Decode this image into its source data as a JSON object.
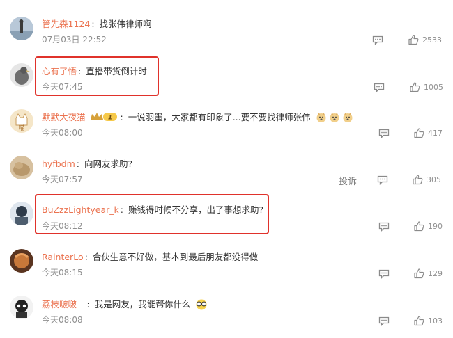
{
  "comments": [
    {
      "username": "管先森1124",
      "text": "找张伟律师啊",
      "time": "07月03日 22:52",
      "likes": "2533",
      "avatar_color": "#9aaec0"
    },
    {
      "username": "心有了悟",
      "text": "直播带货倒计时",
      "time": "今天07:45",
      "likes": "1005",
      "avatar_color": "#7d8880"
    },
    {
      "username": "默默大夜猫",
      "badge_level": "1",
      "text": "一说羽墨，大家都有印象了...要不要找律师张伟",
      "time": "今天08:00",
      "likes": "417",
      "avatar_color": "#f3e2bf"
    },
    {
      "username": "hyfbdm",
      "text": "向网友求助?",
      "time": "今天07:57",
      "likes": "305",
      "report_label": "投诉",
      "avatar_color": "#c9a982"
    },
    {
      "username": "BuZzzLightyear_k",
      "text": "赚钱得时候不分享，出了事想求助?",
      "time": "今天08:12",
      "likes": "190",
      "avatar_color": "#3a4a5c"
    },
    {
      "username": "RainterLo",
      "text": "合伙生意不好做，基本到最后朋友都没得做",
      "time": "今天08:15",
      "likes": "129",
      "avatar_color": "#c8783a"
    },
    {
      "username": "荔枝啵啵__",
      "text": "我是网友，我能帮你什么",
      "time": "今天08:08",
      "likes": "103",
      "avatar_color": "#dcdcdc"
    }
  ],
  "colors": {
    "username": "#eb7350",
    "highlight": "#e0322b",
    "meta": "#8f8f8f"
  },
  "icons": {
    "reply": "comment-bubble-icon",
    "like": "thumbs-up-icon"
  }
}
